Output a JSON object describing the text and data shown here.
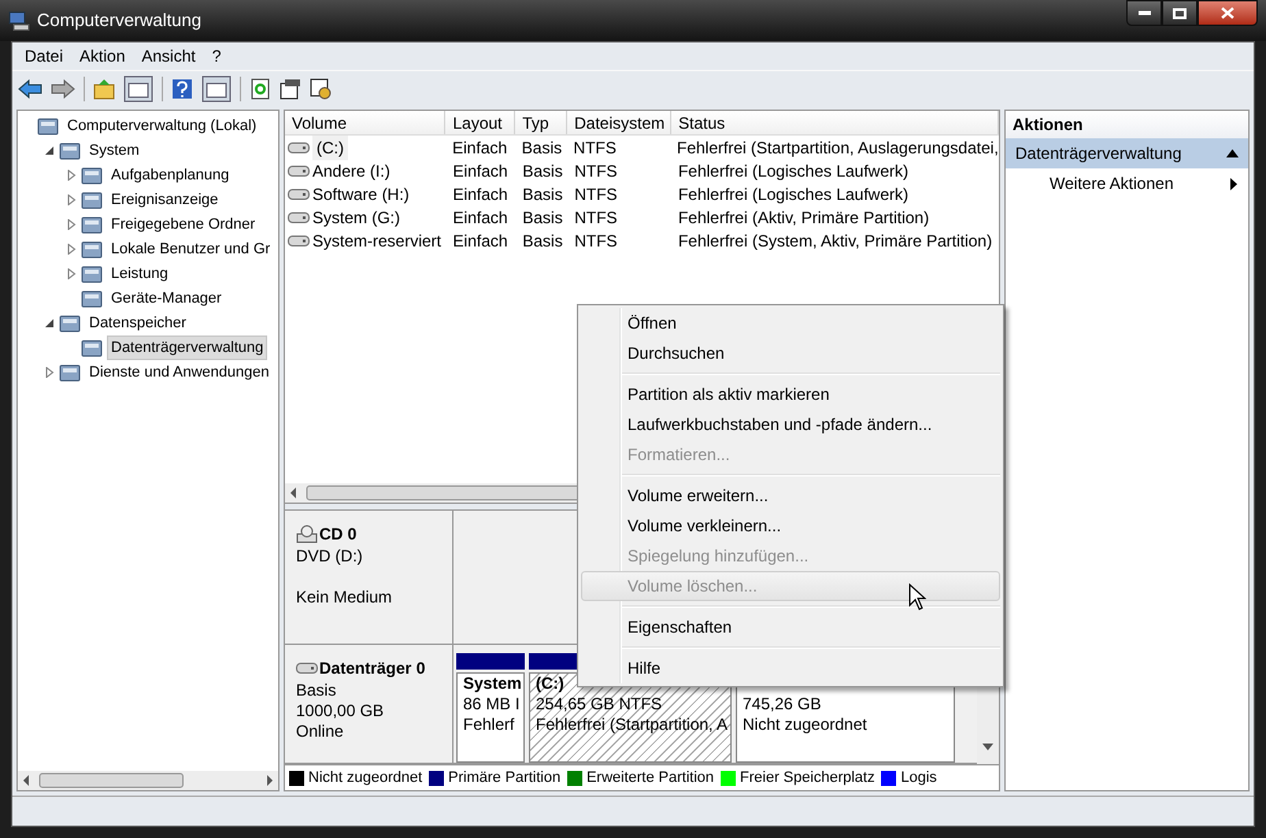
{
  "window": {
    "title": "Computerverwaltung"
  },
  "menu_bar": [
    "Datei",
    "Aktion",
    "Ansicht",
    "?"
  ],
  "tree": [
    {
      "label": "Computerverwaltung (Lokal)",
      "selected": false,
      "children": [
        {
          "label": "System",
          "selected": false,
          "expanded": true,
          "children": [
            {
              "label": "Aufgabenplanung",
              "selected": false,
              "expanded": false
            },
            {
              "label": "Ereignisanzeige",
              "selected": false,
              "expanded": false
            },
            {
              "label": "Freigegebene Ordner",
              "selected": false,
              "expanded": false
            },
            {
              "label": "Lokale Benutzer und Gr",
              "selected": false,
              "expanded": false
            },
            {
              "label": "Leistung",
              "selected": false,
              "expanded": false
            },
            {
              "label": "Geräte-Manager",
              "selected": false
            }
          ]
        },
        {
          "label": "Datenspeicher",
          "selected": false,
          "expanded": true,
          "children": [
            {
              "label": "Datenträgerverwaltung",
              "selected": true
            }
          ]
        },
        {
          "label": "Dienste und Anwendungen",
          "selected": false,
          "expanded": false
        }
      ]
    }
  ],
  "volume_table": {
    "columns": [
      "Volume",
      "Layout",
      "Typ",
      "Dateisystem",
      "Status"
    ],
    "rows": [
      {
        "cells": [
          "(C:)",
          "Einfach",
          "Basis",
          "NTFS",
          "Fehlerfrei (Startpartition, Auslagerungsdatei,"
        ],
        "selected": true
      },
      {
        "cells": [
          "Andere (I:)",
          "Einfach",
          "Basis",
          "NTFS",
          "Fehlerfrei (Logisches Laufwerk)"
        ],
        "selected": false
      },
      {
        "cells": [
          "Software (H:)",
          "Einfach",
          "Basis",
          "NTFS",
          "Fehlerfrei (Logisches Laufwerk)"
        ],
        "selected": false
      },
      {
        "cells": [
          "System (G:)",
          "Einfach",
          "Basis",
          "NTFS",
          "Fehlerfrei (Aktiv, Primäre Partition)"
        ],
        "selected": false
      },
      {
        "cells": [
          "System-reserviert",
          "Einfach",
          "Basis",
          "NTFS",
          "Fehlerfrei (System, Aktiv, Primäre Partition)"
        ],
        "selected": false
      }
    ]
  },
  "disks": [
    {
      "kind": "cdrom",
      "name": "CD 0",
      "lines": [
        "DVD (D:)",
        "Kein Medium"
      ]
    },
    {
      "kind": "disk",
      "name": "Datenträger 0",
      "lines": [
        "Basis",
        "1000,00 GB",
        "Online"
      ],
      "partitions": [
        {
          "name": "System",
          "lines": [
            "86 MB I",
            "Fehlerf"
          ],
          "color": "#000080",
          "selected": false
        },
        {
          "name": "(C:)",
          "lines": [
            "254,65 GB NTFS",
            "Fehlerfrei (Startpartition, A"
          ],
          "color": "#000080",
          "selected": true
        },
        {
          "lines": [
            "745,26 GB",
            "Nicht zugeordnet"
          ],
          "selected": false
        }
      ]
    }
  ],
  "legend": [
    {
      "label": "Nicht zugeordnet",
      "color": "#000000"
    },
    {
      "label": "Primäre Partition",
      "color": "#000080"
    },
    {
      "label": "Erweiterte Partition",
      "color": "#008000"
    },
    {
      "label": "Freier Speicherplatz",
      "color": "#00ff00"
    },
    {
      "label": "Logis",
      "color": "#0000ff"
    }
  ],
  "actions": {
    "title": "Aktionen",
    "section": {
      "label": "Datenträgerverwaltung",
      "expanded": true
    },
    "items": [
      {
        "label": "Weitere Aktionen"
      }
    ]
  },
  "context_menu": [
    {
      "kind": "item",
      "label": "Öffnen",
      "disabled": false,
      "highlighted": false
    },
    {
      "kind": "item",
      "label": "Durchsuchen",
      "disabled": false,
      "highlighted": false
    },
    {
      "kind": "separator"
    },
    {
      "kind": "item",
      "label": "Partition als aktiv markieren",
      "disabled": false,
      "highlighted": false
    },
    {
      "kind": "item",
      "label": "Laufwerkbuchstaben und -pfade ändern...",
      "disabled": false,
      "highlighted": false
    },
    {
      "kind": "item",
      "label": "Formatieren...",
      "disabled": true,
      "highlighted": false
    },
    {
      "kind": "separator"
    },
    {
      "kind": "item",
      "label": "Volume erweitern...",
      "disabled": false,
      "highlighted": false
    },
    {
      "kind": "item",
      "label": "Volume verkleinern...",
      "disabled": false,
      "highlighted": false
    },
    {
      "kind": "item",
      "label": "Spiegelung hinzufügen...",
      "disabled": true,
      "highlighted": false
    },
    {
      "kind": "item",
      "label": "Volume löschen...",
      "disabled": true,
      "highlighted": true
    },
    {
      "kind": "separator"
    },
    {
      "kind": "item",
      "label": "Eigenschaften",
      "disabled": false,
      "highlighted": false
    },
    {
      "kind": "separator"
    },
    {
      "kind": "item",
      "label": "Hilfe",
      "disabled": false,
      "highlighted": false
    }
  ]
}
